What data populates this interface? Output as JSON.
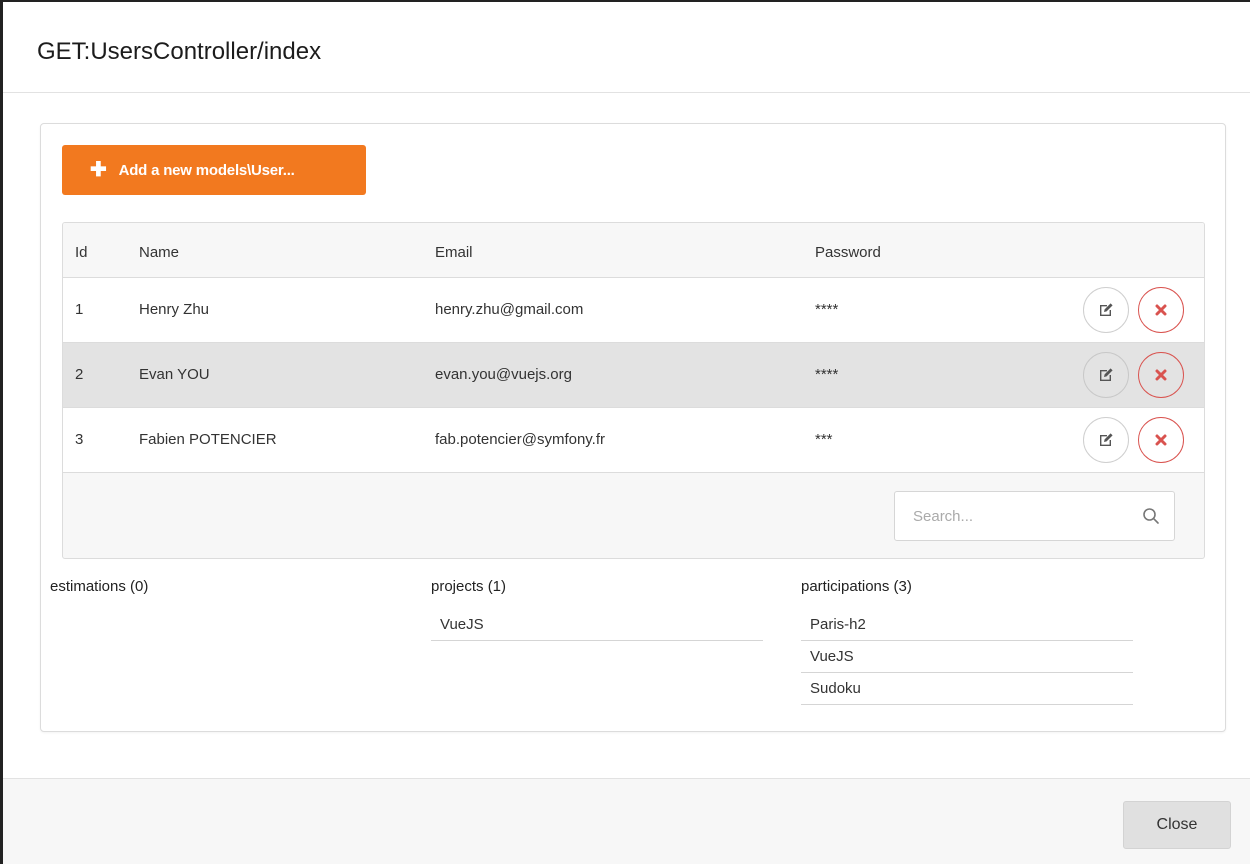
{
  "modal": {
    "title": "GET:UsersController/index"
  },
  "toolbar": {
    "add_label": "Add a new models\\User..."
  },
  "table": {
    "headers": {
      "id": "Id",
      "name": "Name",
      "email": "Email",
      "password": "Password"
    },
    "rows": [
      {
        "id": "1",
        "name": "Henry Zhu",
        "email": "henry.zhu@gmail.com",
        "password": "****"
      },
      {
        "id": "2",
        "name": "Evan YOU",
        "email": "evan.you@vuejs.org",
        "password": "****"
      },
      {
        "id": "3",
        "name": "Fabien POTENCIER",
        "email": "fab.potencier@symfony.fr",
        "password": "***"
      }
    ],
    "row_actions": {
      "edit_icon": "edit-icon",
      "delete_icon": "close-icon"
    }
  },
  "search": {
    "placeholder": "Search...",
    "value": ""
  },
  "relations": {
    "estimations": {
      "title": "estimations (0)",
      "items": []
    },
    "projects": {
      "title": "projects (1)",
      "items": [
        "VueJS"
      ]
    },
    "participations": {
      "title": "participations (3)",
      "items": [
        "Paris-h2",
        "VueJS",
        "Sudoku"
      ]
    }
  },
  "footer": {
    "close_label": "Close"
  },
  "colors": {
    "accent": "#f2791f",
    "danger": "#d9534f",
    "hover_row": "#e3e3e3"
  }
}
